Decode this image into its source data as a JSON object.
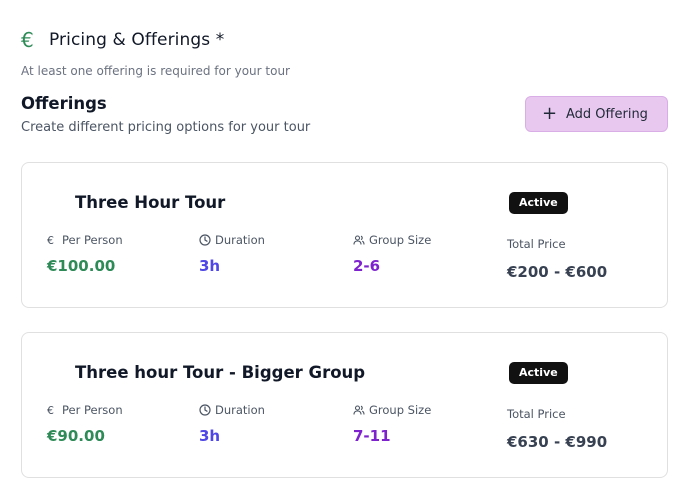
{
  "section": {
    "icon": "euro-icon",
    "title": "Pricing & Offerings *",
    "hint": "At least one offering is required for your tour"
  },
  "offerings": {
    "title": "Offerings",
    "subtitle": "Create different pricing options for your tour",
    "add_button_label": "Add Offering",
    "labels": {
      "per_person": "Per Person",
      "duration": "Duration",
      "group_size": "Group Size",
      "total_price": "Total Price"
    },
    "cards": [
      {
        "title": "Three Hour Tour",
        "status": "Active",
        "price": "€100.00",
        "duration": "3h",
        "group_size": "2-6",
        "total": "€200 - €600"
      },
      {
        "title": "Three hour Tour - Bigger Group",
        "status": "Active",
        "price": "€90.00",
        "duration": "3h",
        "group_size": "7-11",
        "total": "€630 - €990"
      }
    ]
  },
  "colors": {
    "accent_green": "#2e8b57",
    "duration_blue": "#4f46e5",
    "group_purple": "#7e22ce",
    "button_bg": "#e9c8f0"
  }
}
